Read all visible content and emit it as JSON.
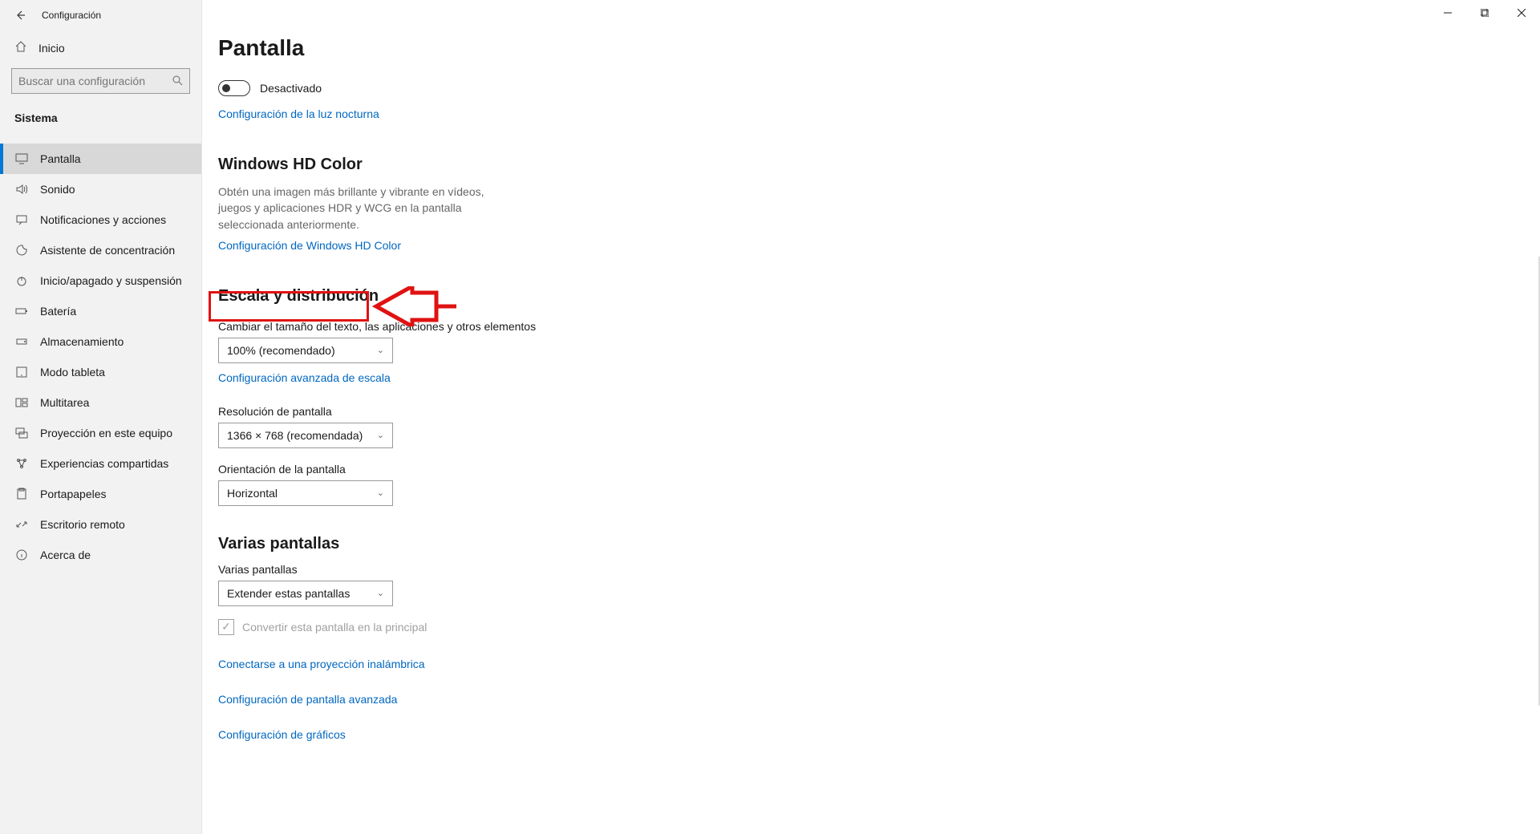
{
  "header": {
    "title": "Configuración",
    "home": "Inicio"
  },
  "search": {
    "placeholder": "Buscar una configuración"
  },
  "section_label": "Sistema",
  "nav": [
    {
      "id": "display",
      "label": "Pantalla",
      "icon": "display-icon",
      "active": true
    },
    {
      "id": "sound",
      "label": "Sonido",
      "icon": "sound-icon"
    },
    {
      "id": "notifications",
      "label": "Notificaciones y acciones",
      "icon": "notifications-icon"
    },
    {
      "id": "focus",
      "label": "Asistente de concentración",
      "icon": "focus-icon"
    },
    {
      "id": "power",
      "label": "Inicio/apagado y suspensión",
      "icon": "power-icon"
    },
    {
      "id": "battery",
      "label": "Batería",
      "icon": "battery-icon"
    },
    {
      "id": "storage",
      "label": "Almacenamiento",
      "icon": "storage-icon"
    },
    {
      "id": "tablet",
      "label": "Modo tableta",
      "icon": "tablet-icon"
    },
    {
      "id": "multitask",
      "label": "Multitarea",
      "icon": "multitask-icon"
    },
    {
      "id": "project",
      "label": "Proyección en este equipo",
      "icon": "project-icon"
    },
    {
      "id": "shared",
      "label": "Experiencias compartidas",
      "icon": "shared-icon"
    },
    {
      "id": "clipboard",
      "label": "Portapapeles",
      "icon": "clipboard-icon"
    },
    {
      "id": "remote",
      "label": "Escritorio remoto",
      "icon": "remote-icon"
    },
    {
      "id": "about",
      "label": "Acerca de",
      "icon": "about-icon"
    }
  ],
  "page": {
    "title": "Pantalla",
    "nightlight_toggle": {
      "state": "off",
      "label": "Desactivado"
    },
    "nightlight_link": "Configuración de la luz nocturna",
    "hdcolor": {
      "heading": "Windows HD Color",
      "desc": "Obtén una imagen más brillante y vibrante en vídeos, juegos y aplicaciones HDR y WCG en la pantalla seleccionada anteriormente.",
      "link": "Configuración de Windows HD Color"
    },
    "scale": {
      "heading": "Escala y distribución",
      "size_label": "Cambiar el tamaño del texto, las aplicaciones y otros elementos",
      "size_value": "100% (recomendado)",
      "advanced_link": "Configuración avanzada de escala",
      "resolution_label": "Resolución de pantalla",
      "resolution_value": "1366 × 768 (recomendada)",
      "orientation_label": "Orientación de la pantalla",
      "orientation_value": "Horizontal"
    },
    "multi": {
      "heading": "Varias pantallas",
      "label": "Varias pantallas",
      "value": "Extender estas pantallas",
      "make_main": "Convertir esta pantalla en la principal"
    },
    "links": {
      "wireless": "Conectarse a una proyección inalámbrica",
      "advanced_display": "Configuración de pantalla avanzada",
      "graphics": "Configuración de gráficos"
    }
  }
}
